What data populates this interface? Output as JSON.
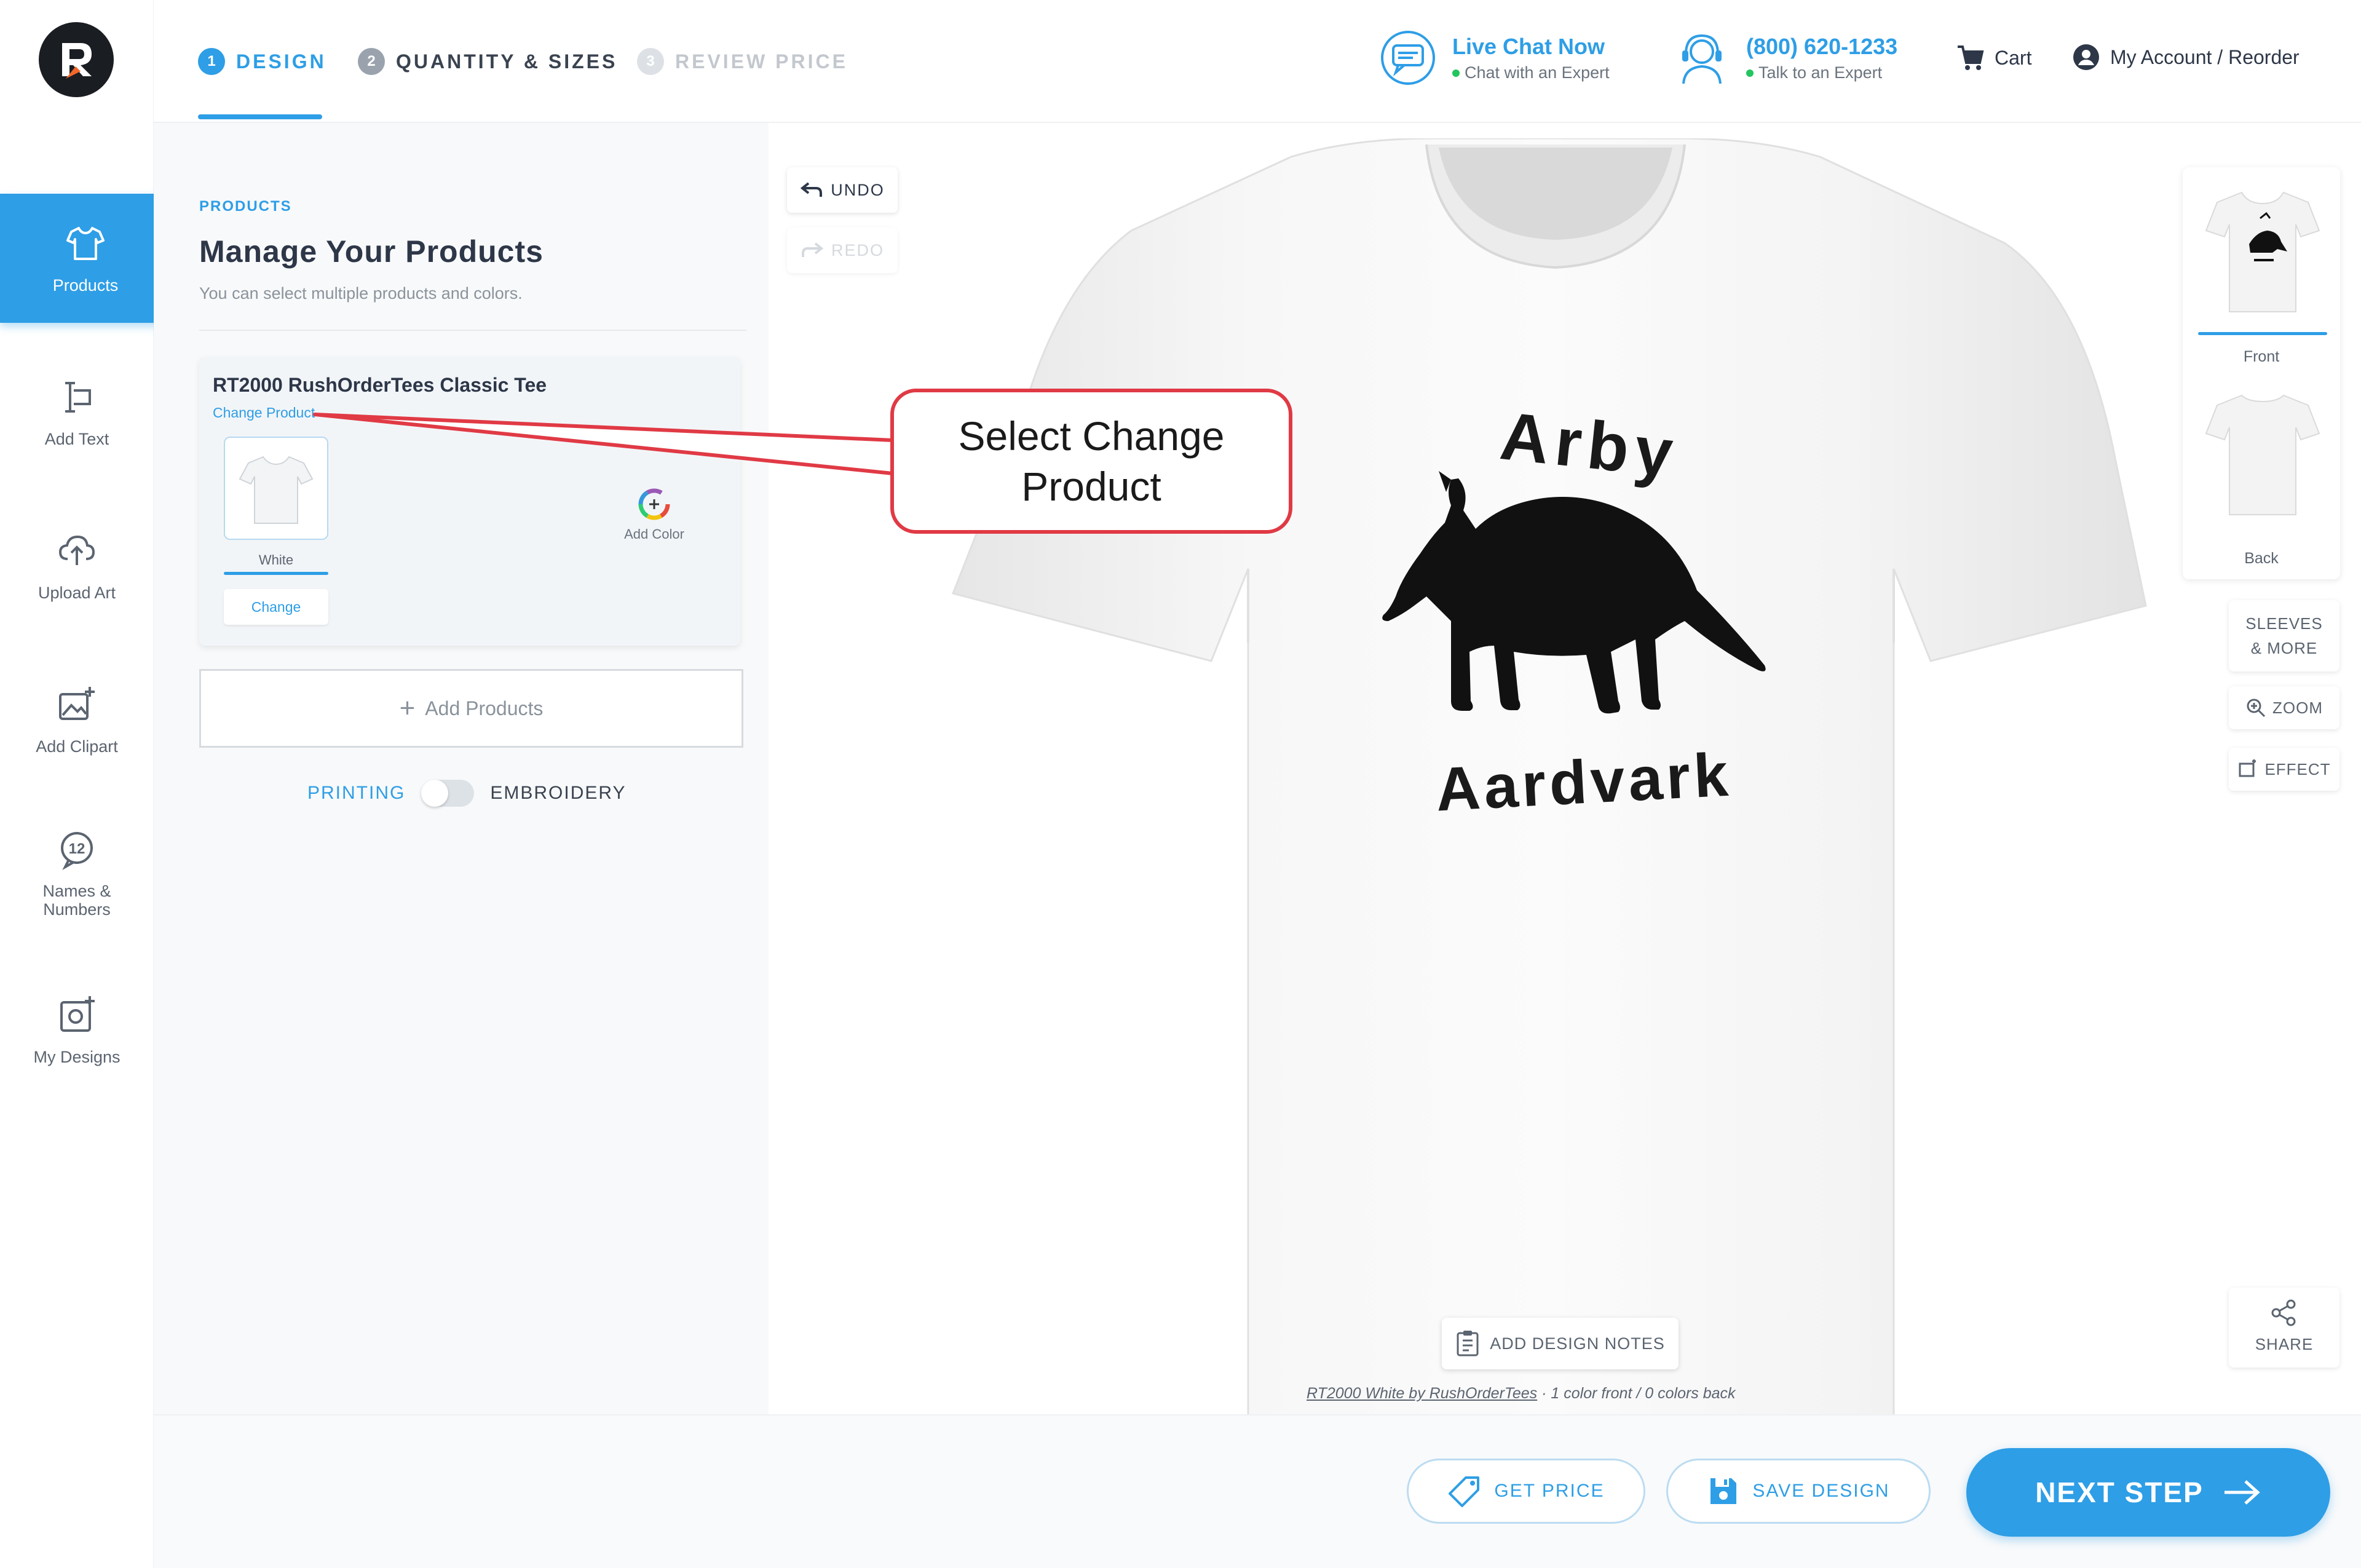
{
  "app": {
    "logo_letter": "R",
    "brand_color": "#2e9ee6"
  },
  "steps": [
    {
      "num": "1",
      "label": "DESIGN",
      "state": "active"
    },
    {
      "num": "2",
      "label": "QUANTITY & SIZES",
      "state": "next"
    },
    {
      "num": "3",
      "label": "REVIEW PRICE",
      "state": "disabled"
    }
  ],
  "header": {
    "chat_title": "Live Chat Now",
    "chat_sub": "Chat with an Expert",
    "phone": "(800) 620-1233",
    "phone_sub": "Talk to an Expert",
    "cart": "Cart",
    "account": "My Account / Reorder"
  },
  "sidebar": {
    "items": [
      {
        "label": "Products",
        "icon": "tshirt-icon"
      },
      {
        "label": "Add Text",
        "icon": "text-cursor-icon"
      },
      {
        "label": "Upload Art",
        "icon": "cloud-upload-icon"
      },
      {
        "label": "Add Clipart",
        "icon": "image-add-icon"
      },
      {
        "label_line1": "Names &",
        "label_line2": "Numbers",
        "icon": "number-badge-icon",
        "badge": "12"
      },
      {
        "label": "My Designs",
        "icon": "designs-icon"
      }
    ]
  },
  "panel": {
    "crumb": "PRODUCTS",
    "title": "Manage Your Products",
    "description": "You can select multiple products and colors.",
    "product_name": "RT2000 RushOrderTees Classic Tee",
    "change_product": "Change Product",
    "color_name": "White",
    "change_button": "Change",
    "add_color": "Add Color",
    "add_products": "Add Products",
    "printing": "PRINTING",
    "embroidery": "EMBROIDERY"
  },
  "canvas": {
    "undo": "UNDO",
    "redo": "REDO",
    "design_top_text": "Arby",
    "design_bottom_text": "Aardvark",
    "add_notes": "ADD DESIGN NOTES",
    "caption_product": "RT2000 White by RushOrderTees",
    "caption_front": " · 1 color front",
    "caption_back": "  /  0 colors back"
  },
  "views": {
    "front": "Front",
    "back": "Back",
    "sleeves_line1": "SLEEVES",
    "sleeves_line2": "& MORE",
    "zoom": "ZOOM",
    "effect": "EFFECT",
    "share": "SHARE"
  },
  "footer": {
    "get_price": "GET PRICE",
    "save_design": "SAVE DESIGN",
    "next_step": "NEXT STEP"
  },
  "callout": {
    "line1": "Select Change",
    "line2": "Product",
    "color": "#e03a45"
  }
}
